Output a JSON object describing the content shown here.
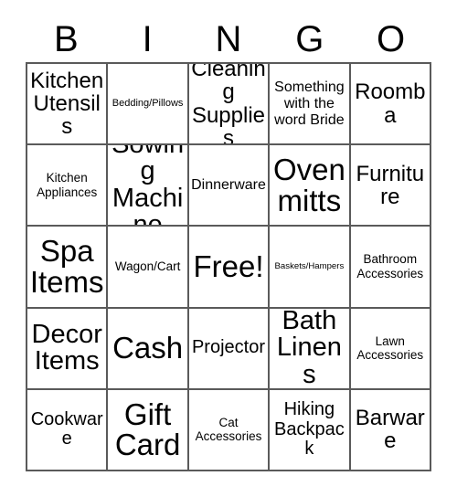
{
  "header": {
    "letters": [
      "B",
      "I",
      "N",
      "G",
      "O"
    ]
  },
  "grid": {
    "rows": 5,
    "columns": 5,
    "border_color": "#5a5a5a",
    "background_color": "#ffffff",
    "text_color": "#000000",
    "cells": [
      [
        {
          "label": "Kitchen Utensils",
          "size": "lg"
        },
        {
          "label": "Bedding/Pillows",
          "size": "xxs"
        },
        {
          "label": "Cleaning Supplies",
          "size": "lg"
        },
        {
          "label": "Something with the word Bride",
          "size": "sm"
        },
        {
          "label": "Roomba",
          "size": "lg"
        }
      ],
      [
        {
          "label": "Kitchen Appliances",
          "size": "xs"
        },
        {
          "label": "Sowing Machine",
          "size": "xl"
        },
        {
          "label": "Dinnerware",
          "size": "sm"
        },
        {
          "label": "Oven mitts",
          "size": "xxl"
        },
        {
          "label": "Furniture",
          "size": "lg"
        }
      ],
      [
        {
          "label": "Spa Items",
          "size": "xxl"
        },
        {
          "label": "Wagon/Cart",
          "size": "xs"
        },
        {
          "label": "Free!",
          "size": "xxl"
        },
        {
          "label": "Baskets/Hampers",
          "size": "tiny"
        },
        {
          "label": "Bathroom Accessories",
          "size": "xs"
        }
      ],
      [
        {
          "label": "Decor Items",
          "size": "xl"
        },
        {
          "label": "Cash",
          "size": "xxl"
        },
        {
          "label": "Projector",
          "size": "md"
        },
        {
          "label": "Bath Linens",
          "size": "xl"
        },
        {
          "label": "Lawn Accessories",
          "size": "xs"
        }
      ],
      [
        {
          "label": "Cookware",
          "size": "md"
        },
        {
          "label": "Gift Card",
          "size": "xxl"
        },
        {
          "label": "Cat Accessories",
          "size": "xs"
        },
        {
          "label": "Hiking Backpack",
          "size": "md"
        },
        {
          "label": "Barware",
          "size": "lg"
        }
      ]
    ]
  }
}
